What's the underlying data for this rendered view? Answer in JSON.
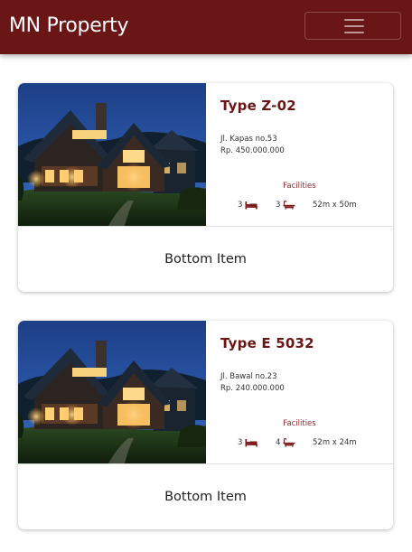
{
  "navbar": {
    "brand": "MN Property",
    "toggler_icon": "hamburger-menu-icon",
    "color": "#6b1616"
  },
  "properties": [
    {
      "type": "Type Z-02",
      "address": "Jl. Kapas no.53",
      "price": "Rp. 450.000.000",
      "facilities_label": "Facilities",
      "bedrooms": "3",
      "bathrooms": "3",
      "land_size": "52m x 50m",
      "bottom_label": "Bottom Item"
    },
    {
      "type": "Type E 5032",
      "address": "Jl. Bawal no.23",
      "price": "Rp. 240.000.000",
      "facilities_label": "Facilities",
      "bedrooms": "3",
      "bathrooms": "4",
      "land_size": "52m x 24m",
      "bottom_label": "Bottom Item"
    }
  ],
  "icons": {
    "bed": "bed-icon",
    "bath": "bathtub-icon"
  }
}
